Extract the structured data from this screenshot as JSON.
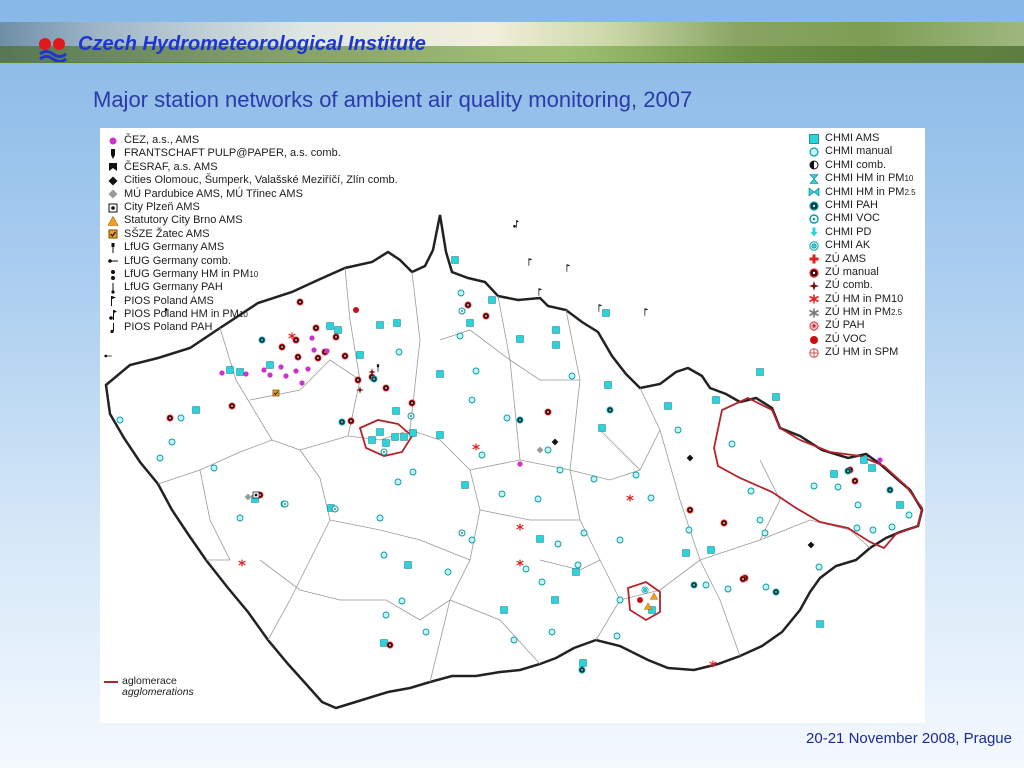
{
  "header": {
    "institute_name": "Czech Hydrometeorological Institute",
    "title": "Major station networks of ambient air quality monitoring, 2007"
  },
  "footer": {
    "date_place": "20-21 November 2008, Prague"
  },
  "colors": {
    "title_text": "#2b3aa8",
    "institute_text": "#1e35d4",
    "border_region": "#b2242a",
    "station_cyan": "#2ad4dc",
    "station_red": "#e02020",
    "station_magenta": "#cc33cc"
  },
  "map": {
    "legend_left": [
      {
        "label": "ČEZ, a.s., AMS",
        "icon": "magenta-dot-icon"
      },
      {
        "label": "FRANTSCHAFT PULP@PAPER, a.s. comb.",
        "icon": "black-down-flag-icon"
      },
      {
        "label": "ČESRAF, a.s. AMS",
        "icon": "black-funnel-icon"
      },
      {
        "label": "Cities Olomouc, Šumperk, Valašské Meziříčí, Zlín comb.",
        "icon": "black-diamond-icon"
      },
      {
        "label": "MÚ Pardubice AMS, MÚ Třinec AMS",
        "icon": "grey-diamond-icon"
      },
      {
        "label": "City Plzeň  AMS",
        "icon": "boxed-dot-icon"
      },
      {
        "label": "Statutory City Brno AMS",
        "icon": "orange-triangle-icon"
      },
      {
        "label": "SŠZE Žatec AMS",
        "icon": "orange-check-box-icon"
      },
      {
        "label": "LfUG Germany AMS",
        "icon": "black-pin-icon"
      },
      {
        "label": "LfUG Germany comb.",
        "icon": "black-arrow-left-icon"
      },
      {
        "label": "LfUG Germany HM in PM",
        "sub": "10",
        "icon": "black-double-dot-icon"
      },
      {
        "label": "LfUG Germany PAH",
        "icon": "black-tick-icon"
      },
      {
        "label": "PIOS Poland AMS",
        "icon": "black-flag-icon"
      },
      {
        "label": "PIOS Poland HM in PM",
        "sub": "10",
        "icon": "black-double-flag-icon"
      },
      {
        "label": "PIOS Poland PAH",
        "icon": "black-j-icon"
      }
    ],
    "legend_right": [
      {
        "label": "CHMI AMS",
        "icon": "cyan-square-icon"
      },
      {
        "label": "CHMI manual",
        "icon": "cyan-circle-icon"
      },
      {
        "label": "CHMI comb.",
        "icon": "half-black-circle-icon"
      },
      {
        "label": "CHMI HM in PM",
        "sub": "10",
        "icon": "cyan-hourglass-icon"
      },
      {
        "label": "CHMI HM in PM",
        "sub": "2.5",
        "icon": "cyan-bowtie-icon"
      },
      {
        "label": "CHMI PAH",
        "icon": "dotted-circle-icon"
      },
      {
        "label": "CHMI VOC",
        "icon": "cyan-ring-dot-icon"
      },
      {
        "label": "CHMI PD",
        "icon": "cyan-down-arrow-icon"
      },
      {
        "label": "CHMI AK",
        "icon": "cyan-double-ring-icon"
      },
      {
        "label": "ZÚ AMS",
        "icon": "red-cross-icon"
      },
      {
        "label": "ZÚ manual",
        "icon": "red-ring-dot-icon"
      },
      {
        "label": "ZÚ comb.",
        "icon": "red-four-star-icon"
      },
      {
        "label": "ZÚ HM in PM10",
        "icon": "red-asterisk-icon"
      },
      {
        "label": "ZÚ HM in PM",
        "sub": "2.5",
        "icon": "grey-asterisk-icon"
      },
      {
        "label": "ZÚ PAH",
        "icon": "red-target-icon"
      },
      {
        "label": "ZÚ VOC",
        "icon": "red-dot-icon"
      },
      {
        "label": "ZÚ HM in SPM",
        "icon": "red-crosshair-circle-icon"
      }
    ],
    "agglomeration_key": {
      "label": "aglomerace",
      "label_en": "agglomerations"
    }
  }
}
